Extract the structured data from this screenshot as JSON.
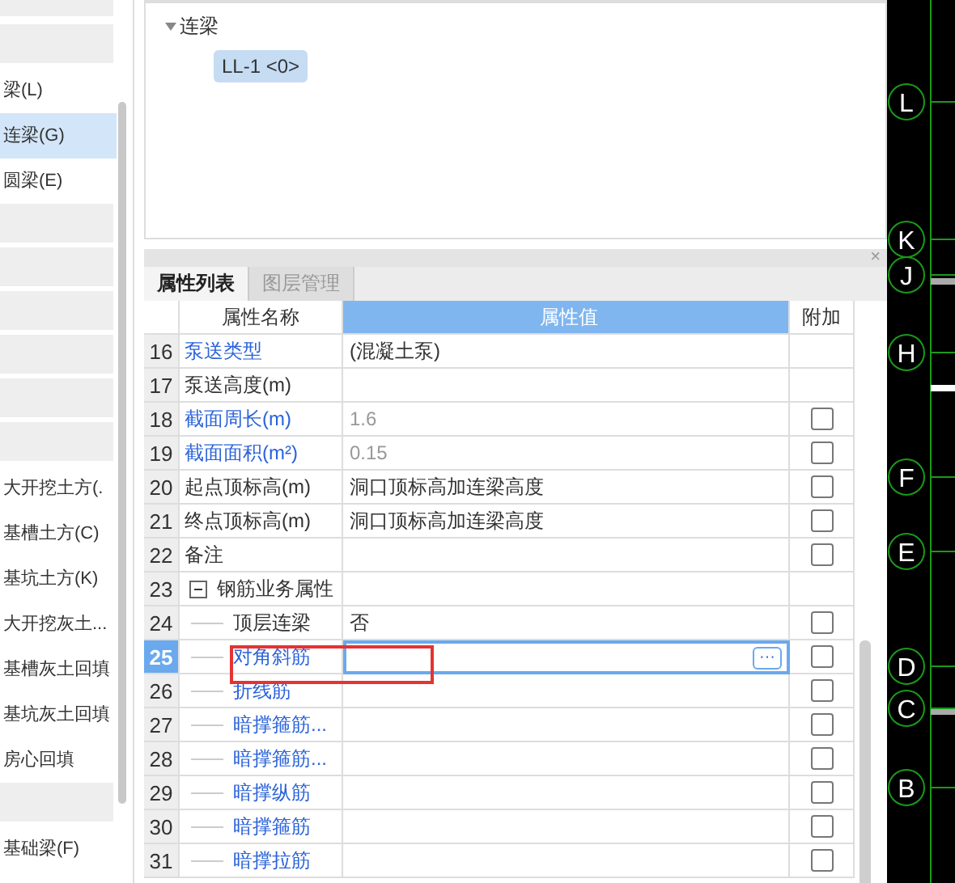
{
  "component_list": [
    {
      "kind": "group",
      "selected": false
    },
    {
      "kind": "group",
      "selected": false
    },
    {
      "kind": "item",
      "label": "梁(L)",
      "selected": false
    },
    {
      "kind": "item",
      "label": "连梁(G)",
      "selected": true
    },
    {
      "kind": "item",
      "label": "圆梁(E)",
      "selected": false
    },
    {
      "kind": "group",
      "selected": false
    },
    {
      "kind": "group",
      "selected": false
    },
    {
      "kind": "group",
      "selected": false
    },
    {
      "kind": "group",
      "selected": false
    },
    {
      "kind": "group",
      "selected": false
    },
    {
      "kind": "group",
      "selected": false
    },
    {
      "kind": "item",
      "label": "大开挖土方(.",
      "selected": false
    },
    {
      "kind": "item",
      "label": "基槽土方(C)",
      "selected": false
    },
    {
      "kind": "item",
      "label": "基坑土方(K)",
      "selected": false
    },
    {
      "kind": "item",
      "label": "大开挖灰土...",
      "selected": false
    },
    {
      "kind": "item",
      "label": "基槽灰土回填",
      "selected": false
    },
    {
      "kind": "item",
      "label": "基坑灰土回填",
      "selected": false
    },
    {
      "kind": "item",
      "label": "房心回填",
      "selected": false
    },
    {
      "kind": "group",
      "selected": false
    },
    {
      "kind": "item",
      "label": "基础梁(F)",
      "selected": false
    }
  ],
  "tree": {
    "label": "连梁",
    "expanded": true,
    "children": [
      {
        "label": "LL-1  <0>",
        "selected": true
      }
    ]
  },
  "panel": {
    "close": "×",
    "tabs": [
      {
        "label": "属性列表",
        "selected": true
      },
      {
        "label": "图层管理",
        "selected": false
      }
    ],
    "columns": [
      "属性名称",
      "属性值",
      "附加"
    ],
    "rows": [
      {
        "num": "16",
        "name": "泵送类型",
        "link": true,
        "value": "(混凝土泵)",
        "disabled": false,
        "selected": false
      },
      {
        "num": "17",
        "name": "泵送高度(m)",
        "link": false,
        "disabled": false,
        "selected": false
      },
      {
        "num": "18",
        "name": "截面周长(m)",
        "link": true,
        "value": "1.6",
        "disabled": true,
        "checked": false,
        "selected": false
      },
      {
        "num": "19",
        "name": "截面面积(m²)",
        "link": true,
        "value": "0.15",
        "disabled": true,
        "checked": false,
        "selected": false
      },
      {
        "num": "20",
        "name": "起点顶标高(m)",
        "link": false,
        "value": "洞口顶标高加连梁高度",
        "disabled": false,
        "checked": false,
        "selected": false
      },
      {
        "num": "21",
        "name": "终点顶标高(m)",
        "link": false,
        "value": "洞口顶标高加连梁高度",
        "disabled": false,
        "checked": false,
        "selected": false
      },
      {
        "num": "22",
        "name": "备注",
        "link": false,
        "disabled": false,
        "checked": false,
        "selected": false
      },
      {
        "num": "23",
        "name": "钢筋业务属性",
        "link": false,
        "disabled": false,
        "expanded": true,
        "selected": false,
        "children": [
          {
            "num": "24",
            "name": "顶层连梁",
            "link": false,
            "value": "否",
            "disabled": false,
            "checked": false,
            "selected": false
          },
          {
            "num": "25",
            "name": "对角斜筋",
            "link": true,
            "disabled": false,
            "checked": false,
            "selected": true,
            "more": "···"
          },
          {
            "num": "26",
            "name": "折线筋",
            "link": true,
            "disabled": false,
            "checked": false,
            "selected": false
          },
          {
            "num": "27",
            "name": "暗撑箍筋...",
            "link": true,
            "disabled": false,
            "checked": false,
            "selected": false
          },
          {
            "num": "28",
            "name": "暗撑箍筋...",
            "link": true,
            "disabled": false,
            "checked": false,
            "selected": false
          },
          {
            "num": "29",
            "name": "暗撑纵筋",
            "link": true,
            "disabled": false,
            "checked": false,
            "selected": false
          },
          {
            "num": "30",
            "name": "暗撑箍筋",
            "link": true,
            "disabled": false,
            "checked": false,
            "selected": false
          },
          {
            "num": "31",
            "name": "暗撑拉筋",
            "link": true,
            "disabled": false,
            "checked": false,
            "selected": false
          }
        ]
      }
    ]
  },
  "cad": {
    "axes": [
      "L",
      "K",
      "J",
      "H",
      "F",
      "E",
      "D",
      "C",
      "B"
    ]
  }
}
